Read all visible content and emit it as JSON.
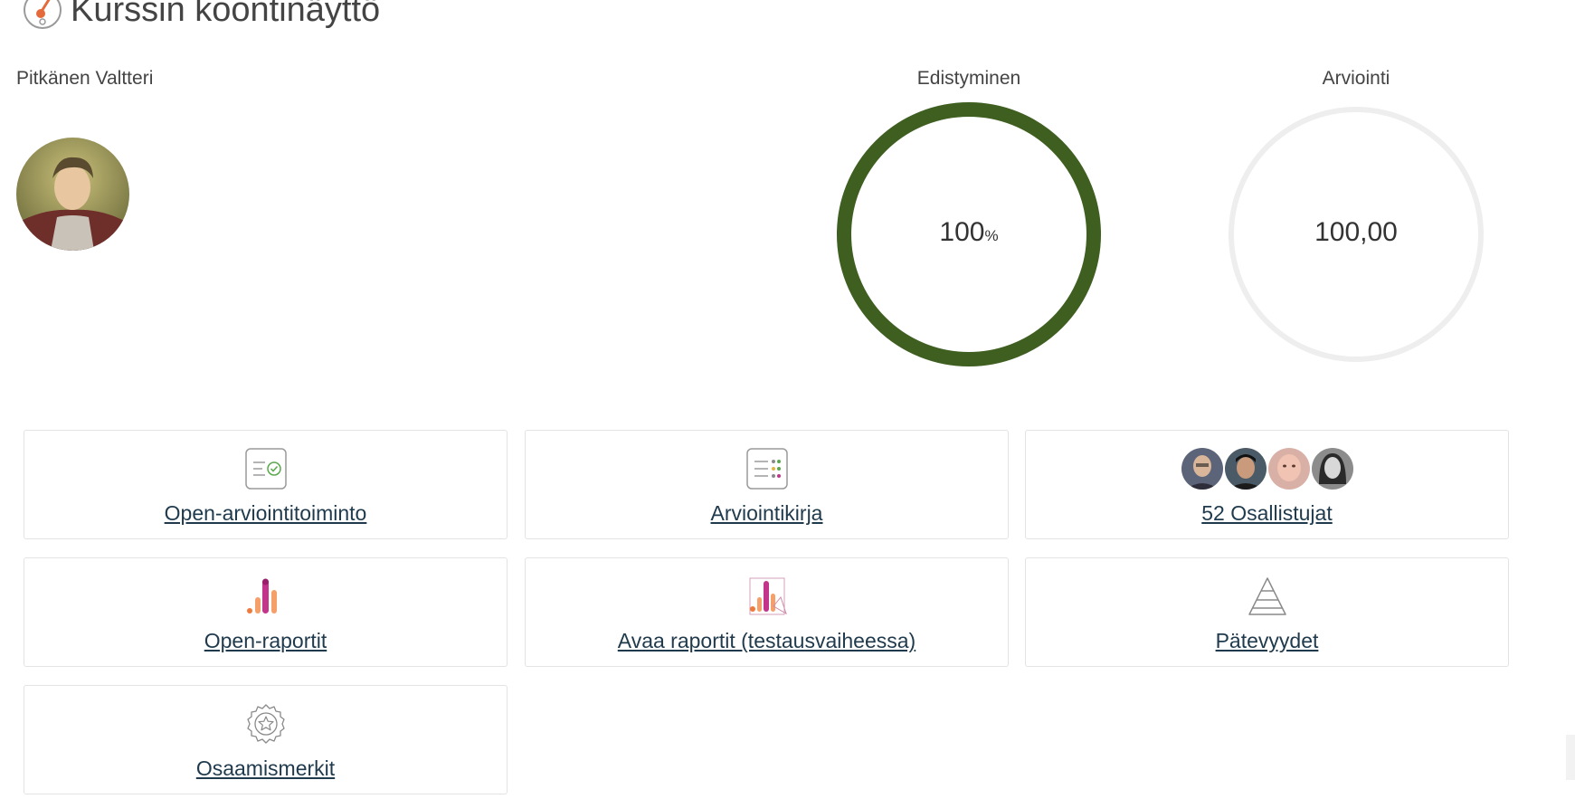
{
  "page": {
    "title": "Kurssin koontinäyttö"
  },
  "user": {
    "name": "Pitkänen Valtteri"
  },
  "progress": {
    "label": "Edistyminen",
    "value": "100",
    "unit": "%",
    "fraction": 1.0,
    "color": "#3e5f20"
  },
  "grade": {
    "label": "Arviointi",
    "value": "100,00"
  },
  "cards": {
    "open_grading": {
      "label": "Open-arviointitoiminto",
      "icon": "checklist-check-icon"
    },
    "gradebook": {
      "label": "Arviointikirja",
      "icon": "gradebook-list-icon"
    },
    "participants": {
      "label": "52 Osallistujat",
      "icon": "participant-avatars"
    },
    "open_reports": {
      "label": "Open-raportit",
      "icon": "bar-chart-icon"
    },
    "open_reports_beta": {
      "label": "Avaa raportit (testausvaiheessa)",
      "icon": "report-chart-icon"
    },
    "competencies": {
      "label": "Pätevyydet",
      "icon": "pyramid-icon"
    },
    "badges": {
      "label": "Osaamismerkit",
      "icon": "badge-star-icon"
    }
  }
}
